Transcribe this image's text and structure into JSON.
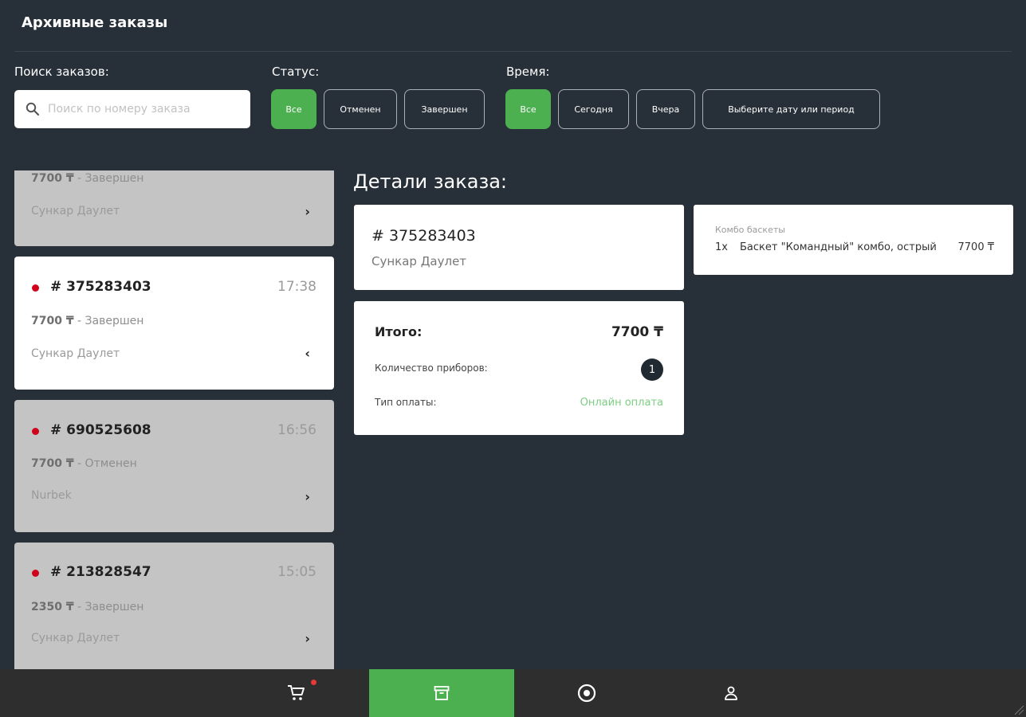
{
  "header": {
    "title": "Архивные заказы"
  },
  "filters": {
    "search_label": "Поиск заказов:",
    "search_placeholder": "Поиск по номеру заказа",
    "status_label": "Статус:",
    "status_options": [
      "Все",
      "Отменен",
      "Завершен"
    ],
    "status_selected": "Все",
    "time_label": "Время:",
    "time_options": [
      "Все",
      "Сегодня",
      "Вчера",
      "Выберите дату или период"
    ],
    "time_selected": "Все"
  },
  "orders": [
    {
      "number": "",
      "time": "",
      "price": "7700 ₸",
      "status": "- Завершен",
      "customer": "Сункар Даулет"
    },
    {
      "number": "# 375283403",
      "time": "17:38",
      "price": "7700 ₸",
      "status": "- Завершен",
      "customer": "Сункар Даулет",
      "selected": true
    },
    {
      "number": "# 690525608",
      "time": "16:56",
      "price": "7700 ₸",
      "status": "- Отменен",
      "customer": "Nurbek"
    },
    {
      "number": "# 213828547",
      "time": "15:05",
      "price": "2350 ₸",
      "status": "- Завершен",
      "customer": "Сункар Даулет"
    }
  ],
  "details": {
    "title": "Детали заказа:",
    "order_number": "# 375283403",
    "customer": "Сункар Даулет",
    "total_label": "Итого:",
    "total_value": "7700 ₸",
    "cutlery_label": "Количество приборов:",
    "cutlery_count": "1",
    "payment_label": "Тип оплаты:",
    "payment_value": "Онлайн оплата",
    "items_category": "Комбо баскеты",
    "items": [
      {
        "qty": "1x",
        "name": "Баскет \"Командный\" комбо, острый",
        "price": "7700 ₸"
      }
    ]
  },
  "nav": [
    {
      "icon": "cart-icon",
      "has_badge": true
    },
    {
      "icon": "archive-icon",
      "active": true
    },
    {
      "icon": "target-icon"
    },
    {
      "icon": "user-icon"
    }
  ],
  "colors": {
    "accent": "#4caf50",
    "background": "#272f38",
    "alert": "#d0021b"
  }
}
